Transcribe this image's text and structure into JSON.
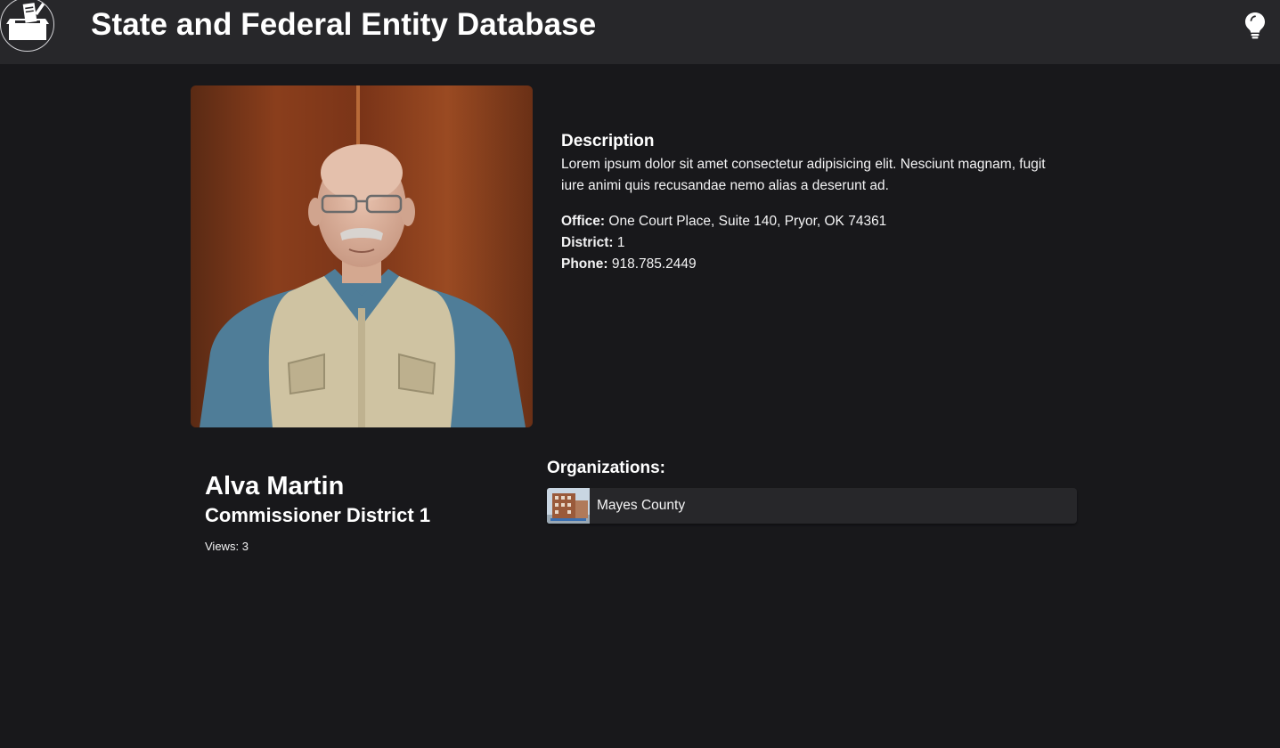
{
  "header": {
    "title": "State and Federal Entity Database",
    "logo_icon": "ballot-box-icon",
    "theme_icon": "lightbulb-icon"
  },
  "profile": {
    "name": "Alva Martin",
    "role": "Commissioner District 1",
    "views_label": "Views:",
    "views": "3",
    "description_heading": "Description",
    "description": "Lorem ipsum dolor sit amet consectetur adipisicing elit. Nesciunt magnam, fugit iure animi quis recusandae nemo alias a deserunt ad.",
    "fields": {
      "office_label": "Office:",
      "office": "One Court Place, Suite 140, Pryor, OK 74361",
      "district_label": "District:",
      "district": "1",
      "phone_label": "Phone:",
      "phone": "918.785.2449"
    }
  },
  "organizations": {
    "heading": "Organizations:",
    "items": [
      {
        "name": "Mayes County"
      }
    ]
  },
  "colors": {
    "background": "#18181b",
    "header": "#27272a",
    "card": "#27272a",
    "text": "#ffffff"
  }
}
